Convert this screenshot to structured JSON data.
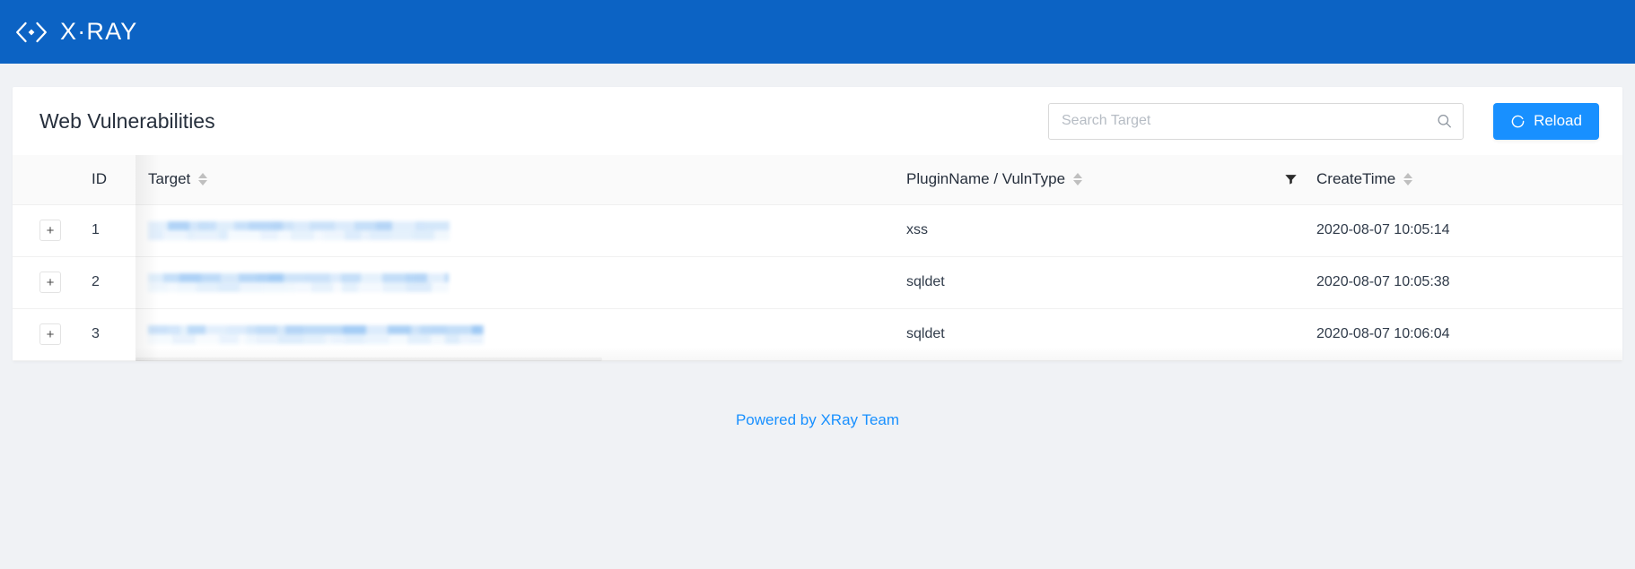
{
  "topbar": {
    "brand_name": "X·RAY",
    "logo_icon": "code-brackets-diamond-icon",
    "background_color": "#0c63c4"
  },
  "card": {
    "title": "Web Vulnerabilities",
    "search": {
      "placeholder": "Search Target",
      "value": "",
      "icon": "search-icon"
    },
    "reload_button": {
      "label": "Reload",
      "icon": "refresh-icon",
      "color": "#1890ff"
    }
  },
  "table": {
    "columns": [
      {
        "key": "expand",
        "label": "",
        "sortable": false,
        "filterable": false
      },
      {
        "key": "id",
        "label": "ID",
        "sortable": false,
        "filterable": false
      },
      {
        "key": "target",
        "label": "Target",
        "sortable": true,
        "filterable": false
      },
      {
        "key": "plugin",
        "label": "PluginName / VulnType",
        "sortable": true,
        "filterable": false
      },
      {
        "key": "filter",
        "label": "",
        "sortable": false,
        "filterable": true
      },
      {
        "key": "time",
        "label": "CreateTime",
        "sortable": true,
        "filterable": false
      }
    ],
    "filter_icon": "filter-funnel-icon",
    "sort_icon": "sort-caret-icon",
    "expand_label": "+",
    "rows": [
      {
        "id": "1",
        "target": "[redacted]",
        "plugin": "xss",
        "time": "2020-08-07 10:05:14"
      },
      {
        "id": "2",
        "target": "[redacted]",
        "plugin": "sqldet",
        "time": "2020-08-07 10:05:38"
      },
      {
        "id": "3",
        "target": "[redacted]",
        "plugin": "sqldet",
        "time": "2020-08-07 10:06:04"
      }
    ],
    "redacted_widths": [
      336,
      335,
      374
    ]
  },
  "footer": {
    "text": "Powered by XRay Team",
    "link_color": "#1890ff"
  }
}
